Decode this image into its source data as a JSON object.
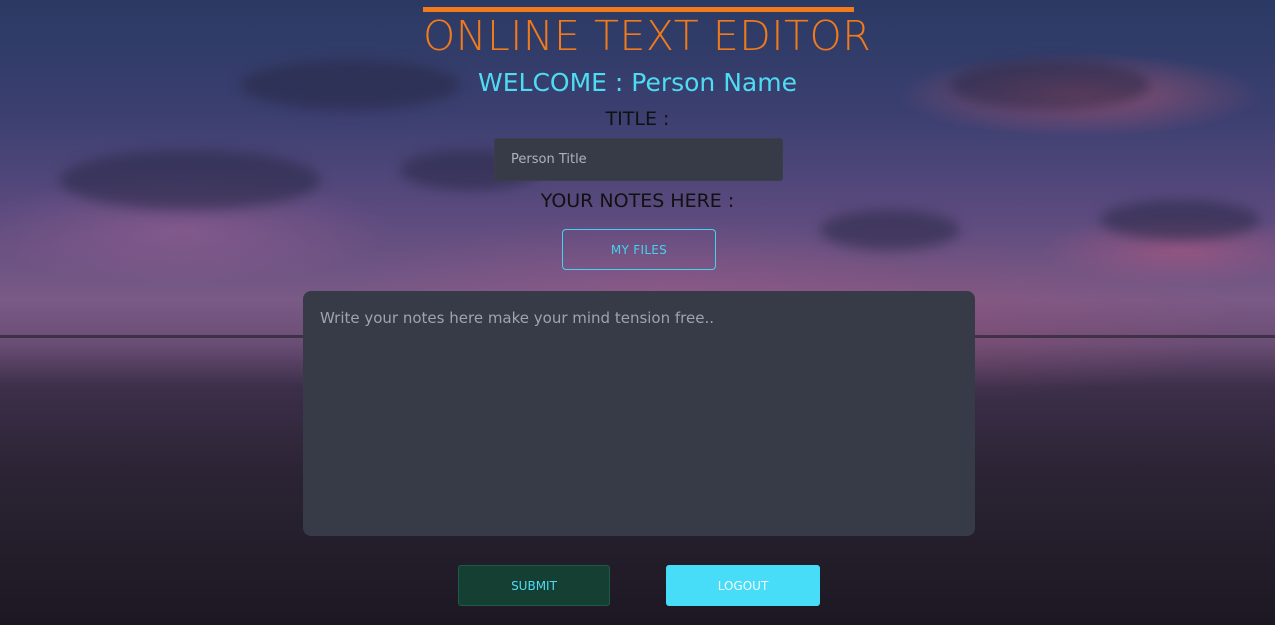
{
  "app": {
    "title": "ONLINE TEXT EDITOR",
    "welcome": "WELCOME : Person Name"
  },
  "form": {
    "title_label": "TITLE :",
    "title_placeholder": "Person Title",
    "notes_label": "YOUR NOTES HERE :",
    "my_files_label": "MY FILES",
    "notes_placeholder": "Write your notes here make your mind tension free..",
    "submit_label": "SUBMIT",
    "logout_label": "LOGOUT"
  },
  "colors": {
    "accent_orange": "#f07a1c",
    "accent_cyan": "#47dcf7",
    "input_bg": "#373b47",
    "submit_bg": "#163f34"
  }
}
